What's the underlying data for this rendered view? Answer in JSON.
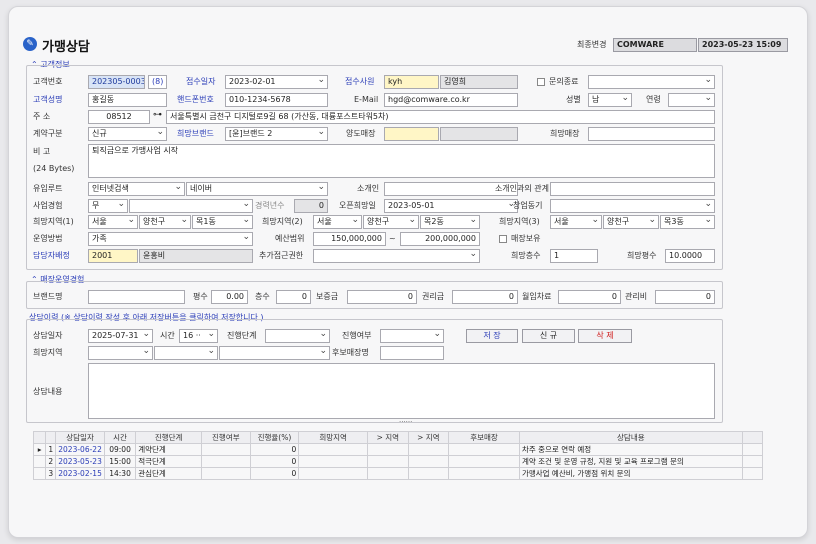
{
  "header": {
    "title": "가맹상담",
    "title_icon": "pencil-icon",
    "last_modified_label": "최종변경",
    "last_modified_user": "COMWARE",
    "last_modified_time": "2023-05-23 15:09"
  },
  "customer": {
    "section_label": "고객정보",
    "customer_no_label": "고객번호",
    "customer_no": "202305-0003",
    "customer_no_count": "(8)",
    "receipt_date_label": "접수일자",
    "receipt_date": "2023-02-01",
    "receiver_label": "접수사원",
    "receiver_id": "kyh",
    "receiver_name": "김영희",
    "inquiry_end_label": "문의종료",
    "name_label": "고객성명",
    "name": "홍길동",
    "phone_label": "핸드폰번호",
    "phone": "010-1234-5678",
    "email_label": "E-Mail",
    "email": "hgd@comware.co.kr",
    "gender_label": "성별",
    "gender": "남",
    "age_label": "연령",
    "address_label": "주    소",
    "zip": "08512",
    "address": "서울특별시 금천구 디지털로9길 68 (가산동, 대륭포스트타워5차)",
    "contract_type_label": "계약구분",
    "contract_type": "신규",
    "desired_brand_label": "희망브랜드",
    "desired_brand": "[윤]브랜드 2",
    "transfer_store_label": "양도매장",
    "desired_store_label": "희망매장",
    "remark_label": "비    고",
    "remark_bytes": "(24 Bytes)",
    "remark": "퇴직금으로 가맹사업 시작",
    "inflow_route_label": "유입루트",
    "inflow_route_1": "인터넷검색",
    "inflow_route_2": "네이버",
    "referrer_label": "소개인",
    "referrer_relation_label": "소개인과의 관계",
    "business_exp_label": "사업경험",
    "business_exp": "무",
    "career_years_label": "경력년수",
    "career_years": "0",
    "open_hope_label": "오픈희망일",
    "open_hope_date": "2023-05-01",
    "motive_label": "창업동기",
    "region1_label": "희망지역(1)",
    "region1": [
      "서울",
      "양천구",
      "목1동"
    ],
    "region2_label": "희망지역(2)",
    "region2": [
      "서울",
      "양천구",
      "목2동"
    ],
    "region3_label": "희망지역(3)",
    "region3": [
      "서울",
      "양천구",
      "목3동"
    ],
    "operation_label": "운영방법",
    "operation": "가족",
    "budget_label": "예산범위",
    "budget_from": "150,000,000",
    "budget_tilde": "~",
    "budget_to": "200,000,000",
    "store_owned_label": "매장보유",
    "manager_label": "담당자배정",
    "manager_id": "2001",
    "manager_name": "윤홍비",
    "extra_auth_label": "추가접근권한",
    "desired_floors_label": "희망층수",
    "desired_floors": "1",
    "desired_area_label": "희망평수",
    "desired_area": "10.0000"
  },
  "store_exp": {
    "section_label": "매장운영경험",
    "brand_name_label": "브랜드명",
    "pyeong_label": "평수",
    "pyeong": "0.00",
    "floors_label": "층수",
    "floors": "0",
    "deposit_label": "보증금",
    "deposit": "0",
    "premium_label": "권리금",
    "premium": "0",
    "monthly_rent_label": "월임차료",
    "monthly_rent": "0",
    "maintenance_label": "관리비",
    "maintenance": "0"
  },
  "history": {
    "section_label": "상담이력 (※ 상담이력 작성 후 아래 저장버튼을 클릭하여 저장합니다.)",
    "date_label": "상담일자",
    "date": "2025-07-31",
    "time_label": "시간",
    "time": "16 ··",
    "stage_label": "진행단계",
    "progress_label": "진행여부",
    "save_button": "저 장",
    "new_button": "신 규",
    "delete_button": "삭 제",
    "region_label": "희망지역",
    "candidate_store_label": "후보매장명",
    "content_label": "상담내용",
    "splitter": "......"
  },
  "table": {
    "headers": [
      "상담일자",
      "시간",
      "진행단계",
      "진행여부",
      "진행율(%)",
      "희망지역",
      "> 지역",
      "> 지역",
      "후보매장",
      "상담내용"
    ],
    "rows": [
      {
        "marker": "▸",
        "no": "1",
        "date": "2023-06-22",
        "time": "09:00",
        "stage": "계약단계",
        "progress": "",
        "rate": "0",
        "region": "",
        "r2": "",
        "r3": "",
        "store": "",
        "content": "차주 중으로 연락 예정"
      },
      {
        "marker": "",
        "no": "2",
        "date": "2023-05-23",
        "time": "15:00",
        "stage": "적극단계",
        "progress": "",
        "rate": "0",
        "region": "",
        "r2": "",
        "r3": "",
        "store": "",
        "content": "계약 조건 및 운영 규정, 지원 및 교육 프로그램 문의"
      },
      {
        "marker": "",
        "no": "3",
        "date": "2023-02-15",
        "time": "14:30",
        "stage": "관심단계",
        "progress": "",
        "rate": "0",
        "region": "",
        "r2": "",
        "r3": "",
        "store": "",
        "content": "가맹사업 예산비, 가맹점 위치 문의"
      }
    ]
  }
}
